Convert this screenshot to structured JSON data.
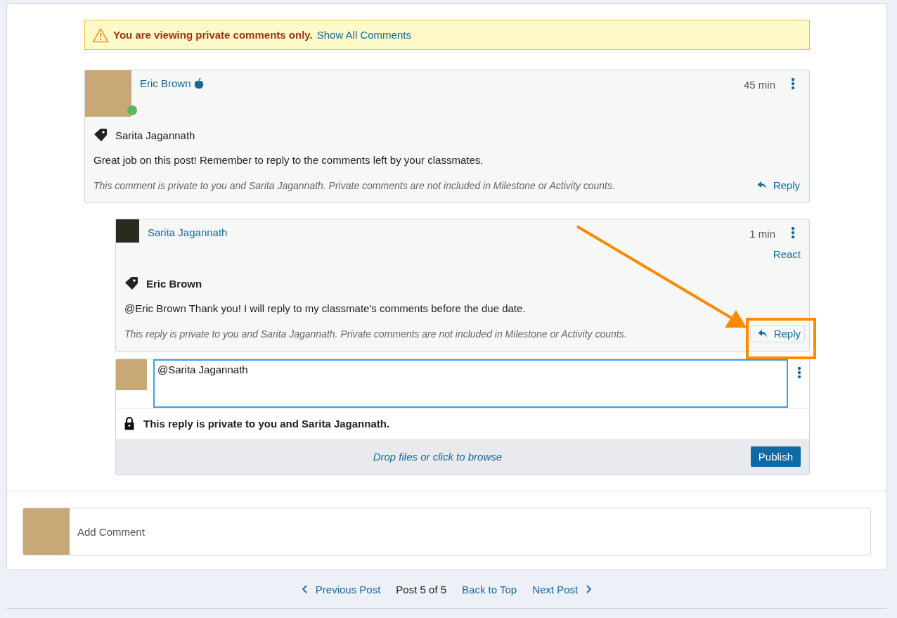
{
  "alert": {
    "message": "You are viewing private comments only.",
    "link": "Show All Comments"
  },
  "comments": [
    {
      "author": "Eric Brown",
      "teacher": true,
      "online": true,
      "nested": false,
      "time": "45 min",
      "tag": "Sarita Jagannath",
      "tag_bold": false,
      "text": "Great job on this post! Remember to reply to the comments left by your classmates.",
      "privacy_note": "This comment is private to you and Sarita Jagannath. Private comments are not included in Milestone or Activity counts.",
      "reply": "Reply"
    },
    {
      "author": "Sarita Jagannath",
      "teacher": false,
      "online": false,
      "nested": true,
      "time": "1 min",
      "react": "React",
      "tag": "Eric Brown",
      "tag_bold": true,
      "text": "@Eric Brown Thank you! I will reply to my classmate's comments before the due date.",
      "privacy_note": "This reply is private to you and Sarita Jagannath. Private comments are not included in Milestone or Activity counts.",
      "reply": "Reply"
    }
  ],
  "composer": {
    "value": "@Sarita Jagannath",
    "privacy": "This reply is private to you and Sarita Jagannath.",
    "dropzone": "Drop files or click to browse",
    "publish": "Publish"
  },
  "add_comment": {
    "placeholder": "Add Comment"
  },
  "post_nav": {
    "previous": "Previous Post",
    "position": "Post 5 of 5",
    "top": "Back to Top",
    "next": "Next Post"
  }
}
